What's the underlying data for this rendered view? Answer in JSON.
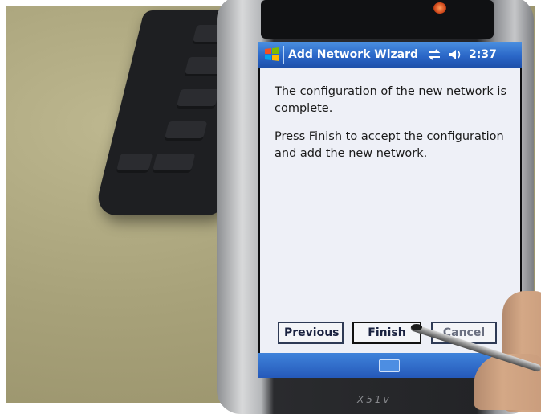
{
  "window": {
    "title": "Add Network Wizard",
    "clock": "2:37"
  },
  "content": {
    "paragraph_1": "The configuration of the new network is complete.",
    "paragraph_2": "Press Finish to accept the configuration and add the new network."
  },
  "buttons": {
    "previous": "Previous",
    "finish": "Finish",
    "cancel": "Cancel"
  },
  "device": {
    "model": "X51v"
  },
  "icons": {
    "start": "windows-start-icon",
    "connectivity": "connectivity-arrows-icon",
    "volume": "speaker-volume-icon",
    "keyboard": "keyboard-icon"
  },
  "colors": {
    "titlebar": "#2a66c7",
    "screen_bg": "#eef0f7",
    "text": "#1a1a1a"
  }
}
